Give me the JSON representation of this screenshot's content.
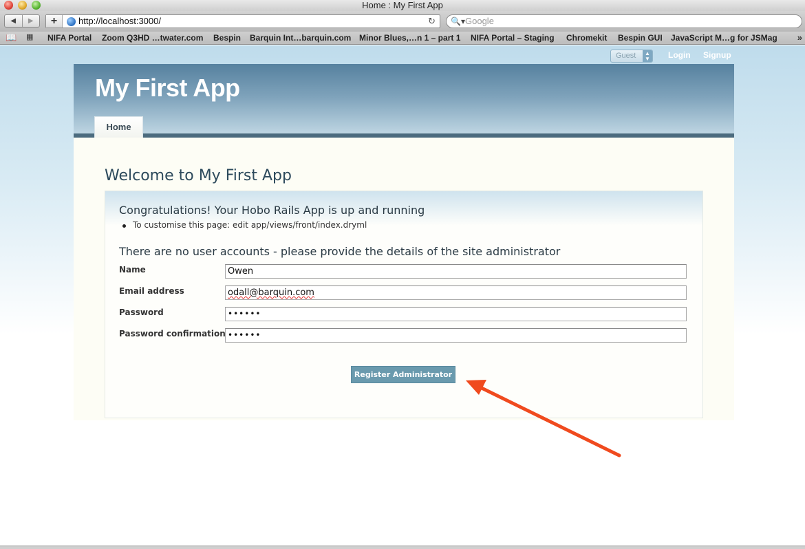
{
  "window": {
    "title": "Home : My First App"
  },
  "toolbar": {
    "back_label": "◀",
    "forward_label": "▶",
    "add_label": "+",
    "url": "http://localhost:3000/",
    "reload_icon": "reload-icon",
    "search_placeholder": "Google"
  },
  "bookmarks": {
    "items": [
      "NIFA Portal",
      "Zoom Q3HD …twater.com",
      "Bespin",
      "Barquin Int…barquin.com",
      "Minor Blues,…n 1 – part 1",
      "NIFA Portal –  Staging",
      "Chromekit",
      "Bespin GUI",
      "JavaScript M…g for JSMag"
    ]
  },
  "account_nav": {
    "guest": "Guest",
    "login": "Login",
    "signup": "Signup"
  },
  "header": {
    "app_name": "My First App",
    "tabs": [
      "Home"
    ]
  },
  "main": {
    "title": "Welcome to My First App",
    "congrats": "Congratulations! Your Hobo Rails App is up and running",
    "tip": "To customise this page: edit app/views/front/index.dryml",
    "admin_heading": "There are no user accounts - please provide the details of the site administrator",
    "form": {
      "fields": [
        {
          "label": "Name",
          "value": "Owen"
        },
        {
          "label": "Email address",
          "value": "odall@barquin.com"
        },
        {
          "label": "Password",
          "value": "••••••"
        },
        {
          "label": "Password confirmation",
          "value": "••••••"
        }
      ],
      "submit_label": "Register Administrator"
    }
  },
  "colors": {
    "header_dark": "#56819f",
    "button": "#6a9aae",
    "annotation_arrow": "#f04a1e"
  }
}
